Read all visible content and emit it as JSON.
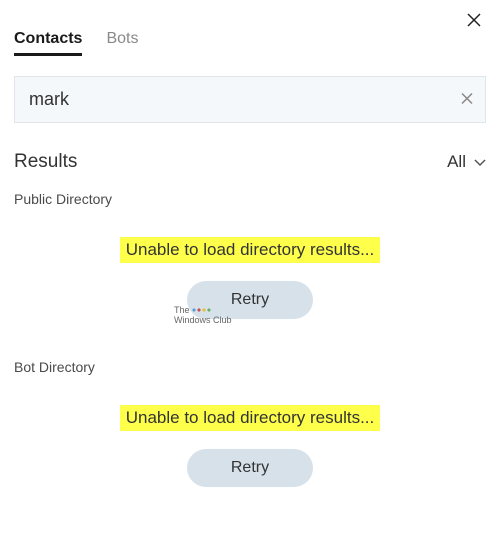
{
  "tabs": {
    "contacts": "Contacts",
    "bots": "Bots"
  },
  "search": {
    "value": "mark",
    "placeholder": ""
  },
  "results": {
    "title": "Results",
    "filter_label": "All"
  },
  "sections": {
    "public": {
      "label": "Public Directory",
      "error": "Unable to load directory results...",
      "retry": "Retry"
    },
    "bot": {
      "label": "Bot Directory",
      "error": "Unable to load directory results...",
      "retry": "Retry"
    }
  },
  "watermark": {
    "line1": "The",
    "line2": "Windows Club"
  }
}
